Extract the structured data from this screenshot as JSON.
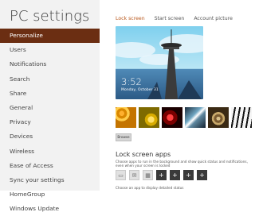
{
  "title": "PC settings",
  "nav": {
    "items": [
      {
        "label": "Personalize",
        "active": true
      },
      {
        "label": "Users"
      },
      {
        "label": "Notifications"
      },
      {
        "label": "Search"
      },
      {
        "label": "Share"
      },
      {
        "label": "General"
      },
      {
        "label": "Privacy"
      },
      {
        "label": "Devices"
      },
      {
        "label": "Wireless"
      },
      {
        "label": "Ease of Access"
      },
      {
        "label": "Sync your settings"
      },
      {
        "label": "HomeGroup"
      },
      {
        "label": "Windows Update"
      }
    ]
  },
  "tabs": [
    {
      "label": "Lock screen",
      "active": true
    },
    {
      "label": "Start screen"
    },
    {
      "label": "Account picture"
    }
  ],
  "lock_preview": {
    "time": "3:52",
    "date": "Monday, October 31"
  },
  "browse_label": "Browse",
  "lock_screen_apps": {
    "title": "Lock screen apps",
    "description": "Choose apps to run in the background and show quick status and notifications, even when your screen is locked",
    "slots": [
      {
        "icon": "chat-icon"
      },
      {
        "icon": "mail-icon"
      },
      {
        "icon": "calendar-icon"
      },
      {
        "icon": "add-icon",
        "label": "+"
      },
      {
        "icon": "add-icon",
        "label": "+"
      },
      {
        "icon": "add-icon",
        "label": "+"
      },
      {
        "icon": "add-icon",
        "label": "+"
      }
    ],
    "detail_text": "Choose an app to display detailed status"
  },
  "colors": {
    "active_nav_bg": "#6b2e12",
    "active_tab": "#b8561a",
    "left_pane_bg": "#f2f2f2"
  }
}
